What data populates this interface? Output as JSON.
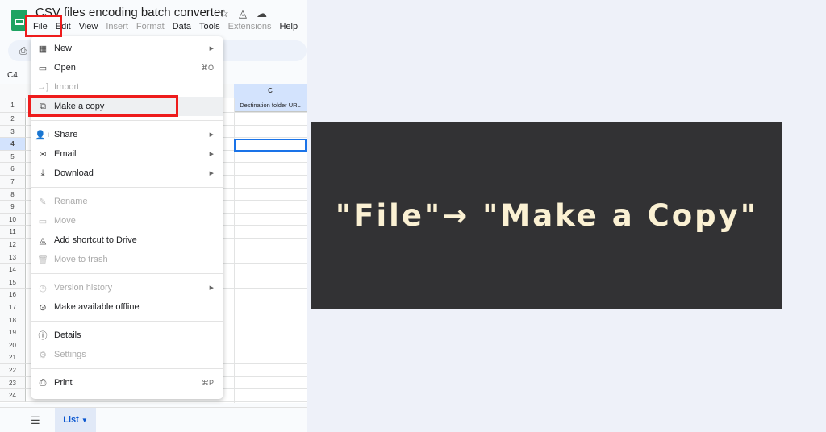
{
  "app": {
    "title": "CSV files encoding batch converter",
    "name_box": "C4"
  },
  "menubar": [
    {
      "label": "File",
      "disabled": false
    },
    {
      "label": "Edit",
      "disabled": false
    },
    {
      "label": "View",
      "disabled": false
    },
    {
      "label": "Insert",
      "disabled": true
    },
    {
      "label": "Format",
      "disabled": true
    },
    {
      "label": "Data",
      "disabled": false
    },
    {
      "label": "Tools",
      "disabled": false
    },
    {
      "label": "Extensions",
      "disabled": true
    },
    {
      "label": "Help",
      "disabled": false
    }
  ],
  "grid": {
    "col_c": "C",
    "c1": "Destination folder URL",
    "rows": [
      "1",
      "2",
      "3",
      "4",
      "5",
      "6",
      "7",
      "8",
      "9",
      "10",
      "11",
      "12",
      "13",
      "14",
      "15",
      "16",
      "17",
      "18",
      "19",
      "20",
      "21",
      "22",
      "23",
      "24"
    ]
  },
  "file_menu": {
    "groups": [
      [
        {
          "label": "New",
          "icon": "▦",
          "sub": true
        },
        {
          "label": "Open",
          "icon": "▭",
          "shortcut": "⌘O"
        },
        {
          "label": "Import",
          "icon": "→]",
          "disabled": true
        },
        {
          "label": "Make a copy",
          "icon": "⧉",
          "highlight": true
        }
      ],
      [
        {
          "label": "Share",
          "icon": "👤+",
          "sub": true
        },
        {
          "label": "Email",
          "icon": "✉",
          "sub": true
        },
        {
          "label": "Download",
          "icon": "⤓",
          "sub": true
        }
      ],
      [
        {
          "label": "Rename",
          "icon": "✎",
          "disabled": true
        },
        {
          "label": "Move",
          "icon": "▭",
          "disabled": true
        },
        {
          "label": "Add shortcut to Drive",
          "icon": "◬"
        },
        {
          "label": "Move to trash",
          "icon": "🗑",
          "disabled": true
        }
      ],
      [
        {
          "label": "Version history",
          "icon": "◷",
          "disabled": true,
          "sub": true
        },
        {
          "label": "Make available offline",
          "icon": "⊙"
        }
      ],
      [
        {
          "label": "Details",
          "icon": "ⓘ"
        },
        {
          "label": "Settings",
          "icon": "⚙",
          "disabled": true
        }
      ],
      [
        {
          "label": "Print",
          "icon": "⎙",
          "shortcut": "⌘P"
        }
      ]
    ]
  },
  "sheet_tab": {
    "label": "List"
  },
  "caption": "\"File\"→ \"Make a Copy\"",
  "colors": {
    "accent": "#1a73e8",
    "highlight_box": "#ee1c1c",
    "card_bg": "#323234",
    "card_text": "#fbf1d3"
  }
}
